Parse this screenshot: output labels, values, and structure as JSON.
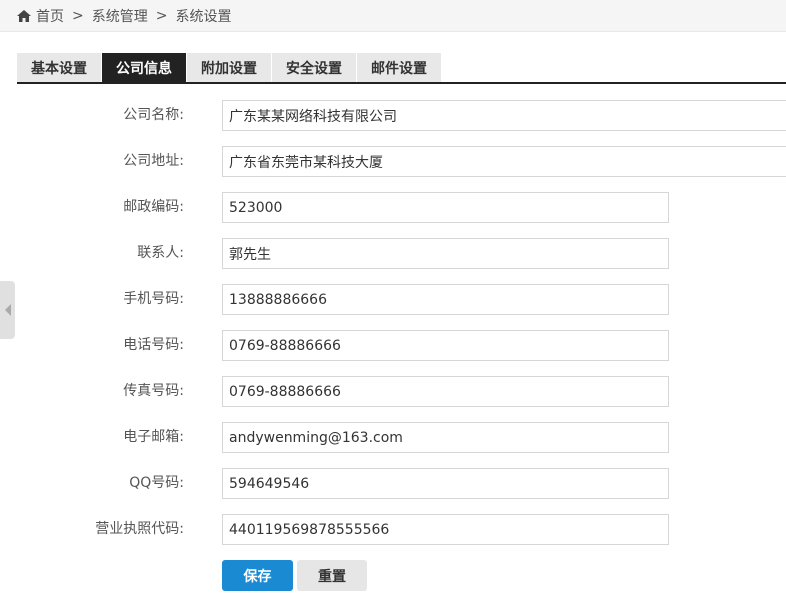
{
  "breadcrumb": {
    "home": "首页",
    "separator": ">",
    "system_management": "系统管理",
    "system_settings": "系统设置"
  },
  "tabs": [
    {
      "label": "基本设置",
      "active": false
    },
    {
      "label": "公司信息",
      "active": true
    },
    {
      "label": "附加设置",
      "active": false
    },
    {
      "label": "安全设置",
      "active": false
    },
    {
      "label": "邮件设置",
      "active": false
    }
  ],
  "form": {
    "company_name": {
      "label": "公司名称:",
      "value": "广东某某网络科技有限公司"
    },
    "company_address": {
      "label": "公司地址:",
      "value": "广东省东莞市某科技大厦"
    },
    "postal_code": {
      "label": "邮政编码:",
      "value": "523000"
    },
    "contact": {
      "label": "联系人:",
      "value": "郭先生"
    },
    "mobile": {
      "label": "手机号码:",
      "value": "13888886666"
    },
    "phone": {
      "label": "电话号码:",
      "value": "0769-88886666"
    },
    "fax": {
      "label": "传真号码:",
      "value": "0769-88886666"
    },
    "email": {
      "label": "电子邮箱:",
      "value": "andywenming@163.com"
    },
    "qq": {
      "label": "QQ号码:",
      "value": "594649546"
    },
    "license": {
      "label": "营业执照代码:",
      "value": "440119569878555566"
    }
  },
  "buttons": {
    "save": "保存",
    "reset": "重置"
  },
  "colors": {
    "primary": "#1a8bd3",
    "tab_active": "#222222"
  },
  "icons": {
    "home": "home-icon",
    "collapse": "chevron-left-icon"
  }
}
